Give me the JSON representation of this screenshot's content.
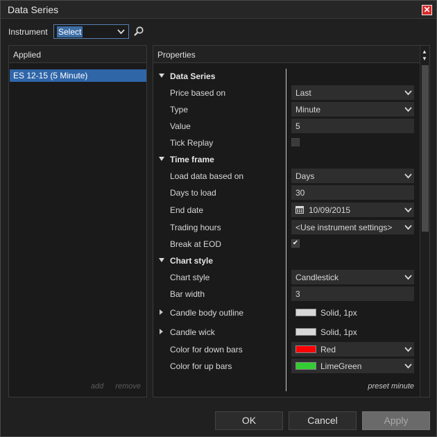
{
  "window": {
    "title": "Data Series"
  },
  "instrument": {
    "label": "Instrument",
    "value": "Select"
  },
  "applied": {
    "header": "Applied",
    "items": [
      "ES 12-15 (5 Minute)"
    ],
    "add_label": "add",
    "remove_label": "remove"
  },
  "properties": {
    "header": "Properties",
    "sections": {
      "data_series": {
        "label": "Data Series",
        "price_based_on": {
          "label": "Price based on",
          "value": "Last"
        },
        "type": {
          "label": "Type",
          "value": "Minute"
        },
        "value": {
          "label": "Value",
          "value": "5"
        },
        "tick_replay": {
          "label": "Tick Replay",
          "checked": false
        }
      },
      "time_frame": {
        "label": "Time frame",
        "load_data_based_on": {
          "label": "Load data based on",
          "value": "Days"
        },
        "days_to_load": {
          "label": "Days to load",
          "value": "30"
        },
        "end_date": {
          "label": "End date",
          "value": "10/09/2015"
        },
        "trading_hours": {
          "label": "Trading hours",
          "value": "<Use instrument settings>"
        },
        "break_at_eod": {
          "label": "Break at EOD",
          "checked": true,
          "check_glyph": "✔"
        }
      },
      "chart_style": {
        "label": "Chart style",
        "chart_style": {
          "label": "Chart style",
          "value": "Candlestick"
        },
        "bar_width": {
          "label": "Bar width",
          "value": "3"
        },
        "candle_body_outline": {
          "label": "Candle body outline",
          "value": "Solid, 1px",
          "color": "#d8d8d8"
        },
        "candle_wick": {
          "label": "Candle wick",
          "value": "Solid, 1px",
          "color": "#d8d8d8"
        },
        "color_down_bars": {
          "label": "Color for down bars",
          "value": "Red",
          "color": "#ff0000"
        },
        "color_up_bars": {
          "label": "Color for up bars",
          "value": "LimeGreen",
          "color": "#32cd32"
        }
      }
    },
    "preset_label": "preset minute"
  },
  "buttons": {
    "ok": "OK",
    "cancel": "Cancel",
    "apply": "Apply"
  },
  "icons": {
    "close": "close-icon",
    "search": "search-icon",
    "chevron": "chevron-down-icon",
    "calendar": "calendar-icon"
  },
  "colors": {
    "accent": "#2f66a8",
    "close": "#d82a2a"
  }
}
